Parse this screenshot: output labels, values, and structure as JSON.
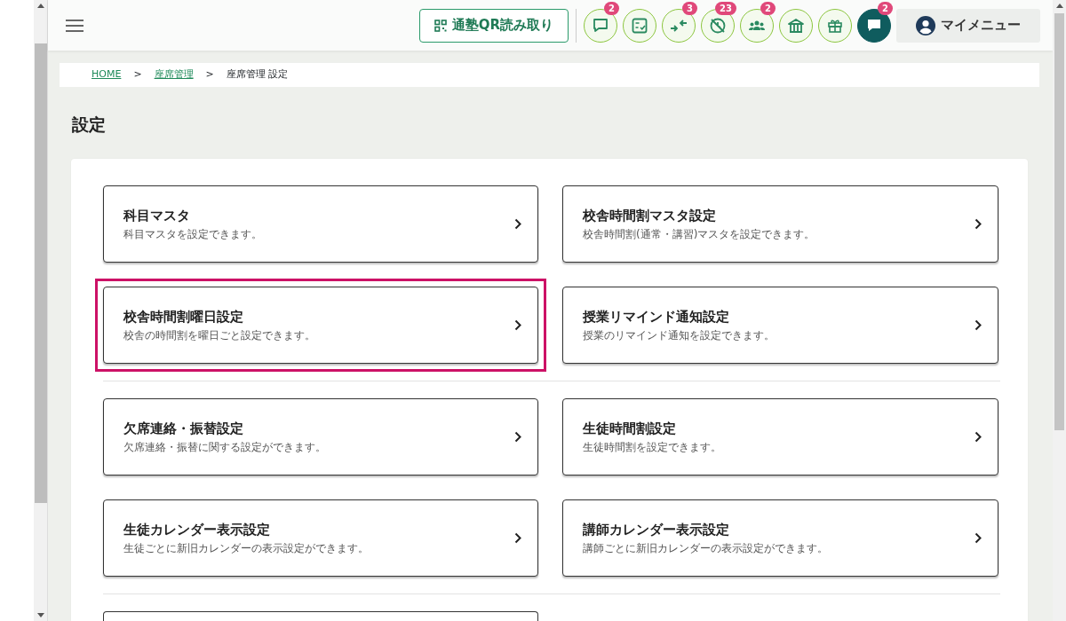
{
  "header": {
    "qr_button": "通塾QR読み取り",
    "icons": [
      {
        "kind": "chat",
        "badge": "2"
      },
      {
        "kind": "checklist"
      },
      {
        "kind": "arrows-in",
        "badge": "3"
      },
      {
        "kind": "no-clock",
        "badge": "23"
      },
      {
        "kind": "group",
        "badge": "2"
      },
      {
        "kind": "bank"
      },
      {
        "kind": "gift"
      },
      {
        "kind": "chat-dark",
        "badge": "2"
      }
    ],
    "my_menu": "マイメニュー"
  },
  "breadcrumb": [
    {
      "label": "HOME",
      "link": true
    },
    {
      "label": "座席管理",
      "link": true
    },
    {
      "label": "座席管理 設定",
      "link": false
    }
  ],
  "breadcrumb_separator": ">",
  "page_title": "設定",
  "sections": [
    {
      "cards": [
        {
          "title": "科目マスタ",
          "description": "科目マスタを設定できます。",
          "highlighted": false
        },
        {
          "title": "校舎時間割マスタ設定",
          "description": "校舎時間割(通常・講習)マスタを設定できます。",
          "highlighted": false
        },
        {
          "title": "校舎時間割曜日設定",
          "description": "校舎の時間割を曜日ごと設定できます。",
          "highlighted": true
        },
        {
          "title": "授業リマインド通知設定",
          "description": "授業のリマインド通知を設定できます。",
          "highlighted": false
        }
      ]
    },
    {
      "cards": [
        {
          "title": "欠席連絡・振替設定",
          "description": "欠席連絡・振替に関する設定ができます。",
          "highlighted": false
        },
        {
          "title": "生徒時間割設定",
          "description": "生徒時間割を設定できます。",
          "highlighted": false
        },
        {
          "title": "生徒カレンダー表示設定",
          "description": "生徒ごとに新旧カレンダーの表示設定ができます。",
          "highlighted": false
        },
        {
          "title": "講師カレンダー表示設定",
          "description": "講師ごとに新旧カレンダーの表示設定ができます。",
          "highlighted": false
        }
      ]
    },
    {
      "cards": [
        {
          "kind": "cut-off"
        }
      ]
    }
  ]
}
